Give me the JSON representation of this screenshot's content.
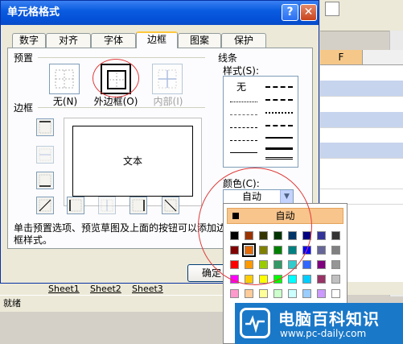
{
  "dialog": {
    "title": "单元格格式",
    "help_label": "?",
    "close_label": "✕",
    "tabs": [
      {
        "label": "数字"
      },
      {
        "label": "对齐"
      },
      {
        "label": "字体"
      },
      {
        "label": "边框"
      },
      {
        "label": "图案"
      },
      {
        "label": "保护"
      }
    ],
    "active_tab": "边框",
    "presets_group_label": "预置",
    "presets": [
      {
        "label": "无(N)",
        "state": "normal"
      },
      {
        "label": "外边框(O)",
        "state": "pressed"
      },
      {
        "label": "内部(I)",
        "state": "disabled"
      }
    ],
    "border_group_label": "边框",
    "preview_text": "文本",
    "line_group_label": "线条",
    "style_label": "样式(S):",
    "style_none": "无",
    "color_label": "颜色(C):",
    "color_value": "自动",
    "hint": "单击预置选项、预览草图及上面的按钮可以添加边框样式。",
    "ok_label": "确定"
  },
  "palette": {
    "auto_label": "自动",
    "selected_color": "#e36c09",
    "rows": [
      [
        "#000000",
        "#993300",
        "#333300",
        "#003300",
        "#003366",
        "#000080",
        "#333399",
        "#333333"
      ],
      [
        "#800000",
        "#e36c09",
        "#808000",
        "#008000",
        "#008080",
        "#0000ff",
        "#666699",
        "#808080"
      ],
      [
        "#ff0000",
        "#ff9900",
        "#99cc00",
        "#339966",
        "#33cccc",
        "#3366ff",
        "#800080",
        "#969696"
      ],
      [
        "#ff00ff",
        "#ffcc00",
        "#ffff00",
        "#00ff00",
        "#00ffff",
        "#00ccff",
        "#993366",
        "#c0c0c0"
      ],
      [
        "#ff99cc",
        "#ffcc99",
        "#ffff99",
        "#ccffcc",
        "#ccffff",
        "#99ccff",
        "#cc99ff",
        "#ffffff"
      ]
    ]
  },
  "excel": {
    "column_header": "F",
    "sheet_tabs": [
      "Sheet1",
      "Sheet2",
      "Sheet3"
    ],
    "status": "就绪"
  },
  "watermark": {
    "title": "电脑百科知识",
    "url": "www.pc-daily.com"
  }
}
